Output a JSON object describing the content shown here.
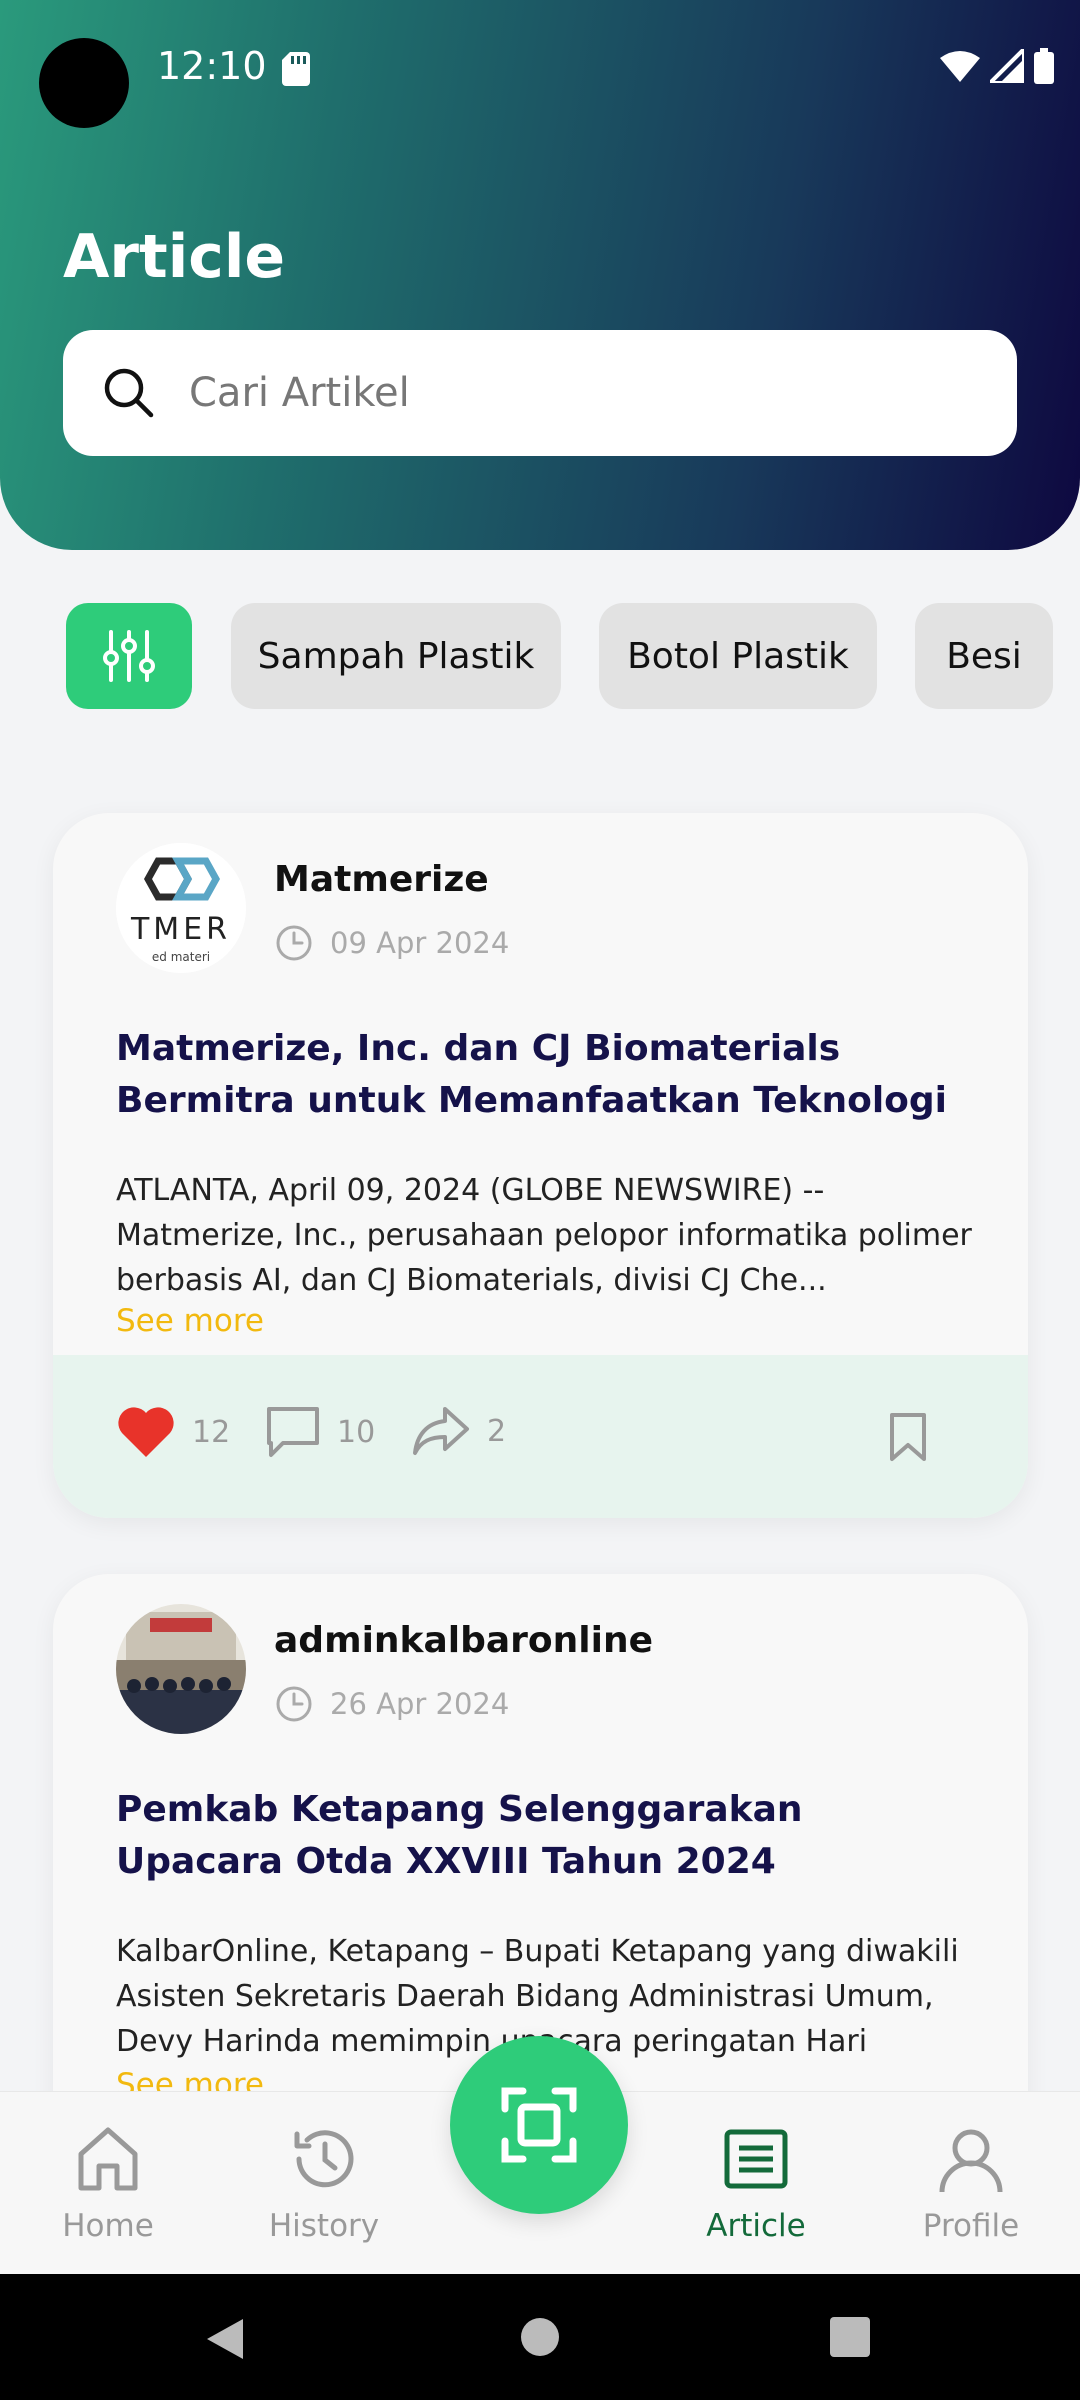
{
  "status_bar": {
    "time": "12:10",
    "icons": [
      "sd-card-icon",
      "wifi-icon",
      "signal-icon",
      "battery-icon"
    ]
  },
  "header": {
    "title": "Article",
    "search": {
      "placeholder": "Cari Artikel",
      "value": ""
    }
  },
  "filter": {
    "icon": "sliders-icon",
    "chips": [
      "Sampah Plastik",
      "Botol Plastik",
      "Besi"
    ]
  },
  "articles": [
    {
      "author": "Matmerize",
      "date": "09 Apr 2024",
      "title": "Matmerize, Inc. dan CJ Biomaterials Bermitra untuk Memanfaatkan Teknologi AI yang Inova...",
      "body": "ATLANTA, April 09, 2024 (GLOBE NEWSWIRE) -- Matmerize, Inc., perusahaan pelopor informatika polimer berbasis AI, dan CJ Biomaterials, divisi CJ Che...",
      "see_more": "See more",
      "logo_text": "TMER",
      "logo_subtext": "ed materi",
      "likes": "12",
      "comments": "10",
      "shares": "2",
      "liked": true
    },
    {
      "author": "adminkalbaronline",
      "date": "26 Apr 2024",
      "title": "Pemkab Ketapang Selenggarakan Upacara Otda XXVIII Tahun 2024",
      "body": "KalbarOnline, Ketapang – Bupati Ketapang yang diwakili Asisten Sekretaris Daerah Bidang Administrasi Umum, Devy Harinda memimpin upacara peringatan Hari Oton...",
      "see_more": "See more"
    }
  ],
  "bottom_nav": {
    "items": [
      {
        "label": "Home",
        "icon": "home-icon"
      },
      {
        "label": "History",
        "icon": "history-icon"
      },
      {
        "label": "Article",
        "icon": "article-icon",
        "active": true
      },
      {
        "label": "Profile",
        "icon": "profile-icon"
      }
    ],
    "scan_icon": "scan-icon"
  },
  "colors": {
    "accent": "#2ecc7a",
    "title": "#15124a",
    "see_more": "#f2b90f",
    "active_nav": "#136a3a",
    "like": "#e8332a"
  }
}
